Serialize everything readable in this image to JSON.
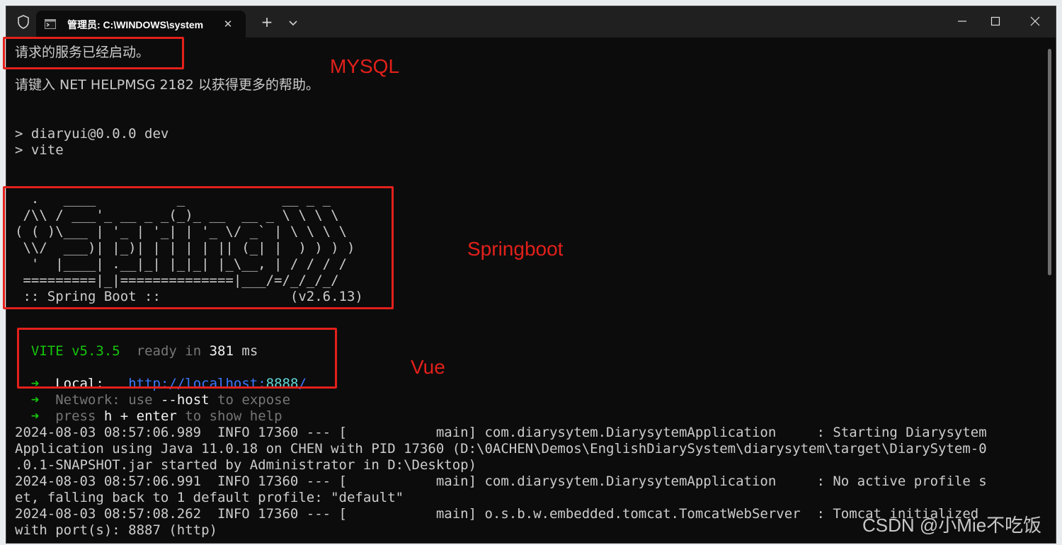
{
  "window": {
    "tab_title": "管理员: C:\\WINDOWS\\system",
    "new_tab_label": "+"
  },
  "terminal": {
    "lines": [
      "请求的服务已经启动。",
      "请键入 NET HELPMSG 2182 以获得更多的帮助。",
      "> diaryui@0.0.0 dev",
      "> vite",
      "  .   ____          _            __ _ _",
      " /\\\\ / ___'_ __ _ _(_)_ __  __ _ \\ \\ \\ \\",
      "( ( )\\___ | '_ | '_| | '_ \\/ _` | \\ \\ \\ \\",
      " \\\\/  ___)| |_)| | | | | || (_| |  ) ) ) )",
      "  '  |____| .__|_| |_|_| |_\\__, | / / / /",
      " =========|_|==============|___/=/_/_/_/",
      " :: Spring Boot ::                (v2.6.13)"
    ],
    "vite": {
      "name": "VITE",
      "version": "v5.3.5",
      "ready_text": "ready in",
      "ready_ms": "381",
      "ms_unit": "ms",
      "arrow": "➜",
      "local_label": "Local:",
      "local_url_prefix": "http://localhost:",
      "local_port": "8888",
      "local_url_suffix": "/",
      "network_label": "Network:",
      "network_use": "use",
      "network_flag": "--host",
      "network_tail": "to expose",
      "help_press": "press",
      "help_key": "h + enter",
      "help_tail": "to show help"
    },
    "log_lines": [
      "2024-08-03 08:57:06.989  INFO 17360 --- [           main] com.diarysytem.DiarysytemApplication     : Starting Diarysytem",
      "Application using Java 11.0.18 on CHEN with PID 17360 (D:\\0ACHEN\\Demos\\EnglishDiarySystem\\diarysytem\\target\\DiarySytem-0",
      ".0.1-SNAPSHOT.jar started by Administrator in D:\\Desktop)",
      "2024-08-03 08:57:06.991  INFO 17360 --- [           main] com.diarysytem.DiarysytemApplication     : No active profile s",
      "et, falling back to 1 default profile: \"default\"",
      "2024-08-03 08:57:08.262  INFO 17360 --- [           main] o.s.b.w.embedded.tomcat.TomcatWebServer  : Tomcat initialized",
      "with port(s): 8887 (http)"
    ]
  },
  "annotations": {
    "mysql": "MYSQL",
    "springboot": "Springboot",
    "vue": "Vue"
  },
  "watermark": "CSDN @小Mie不吃饭",
  "colors": {
    "terminal_bg": "#0c0c0c",
    "terminal_text": "#cccccc",
    "vite_green": "#16c60c",
    "link_blue": "#3b78ff",
    "annotation_red": "#e3201b"
  },
  "icons": {
    "shield": "shield-icon",
    "terminal": "terminal-icon",
    "close": "close-icon",
    "chevron": "chevron-down-icon",
    "minimize": "minimize-icon",
    "maximize": "maximize-icon"
  }
}
